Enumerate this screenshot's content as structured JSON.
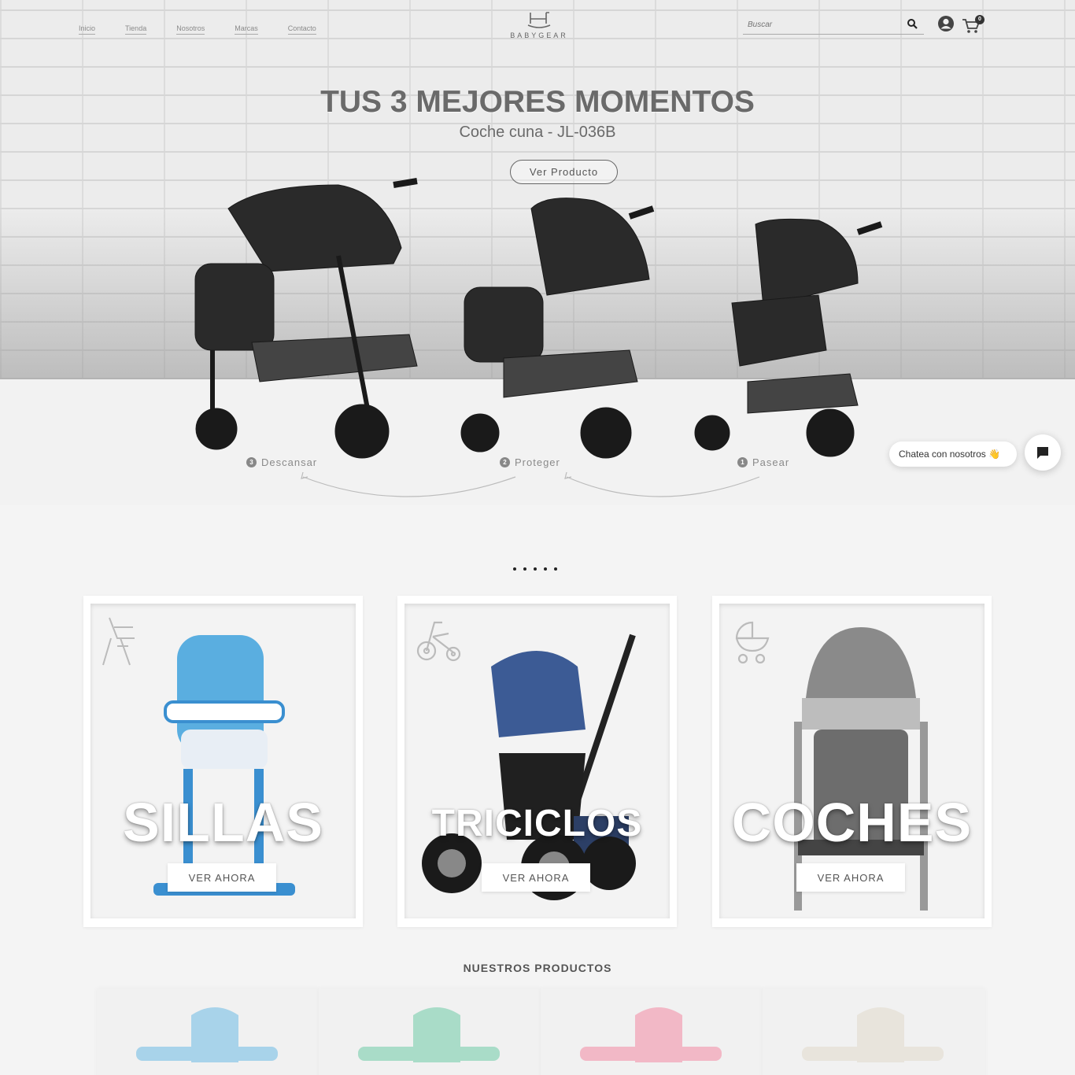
{
  "header": {
    "nav": [
      "Inicio",
      "Tienda",
      "Nosotros",
      "Marcas",
      "Contacto"
    ],
    "logo_text": "BABYGEAR",
    "search_placeholder": "Buscar",
    "cart_count": "0"
  },
  "hero": {
    "title": "TUS 3 MEJORES MOMENTOS",
    "subtitle": "Coche cuna - JL-036B",
    "button": "Ver Producto",
    "steps": [
      {
        "num": "3",
        "label": "Descansar"
      },
      {
        "num": "2",
        "label": "Proteger"
      },
      {
        "num": "1",
        "label": "Pasear"
      }
    ]
  },
  "chat": {
    "label": "Chatea con nosotros 👋"
  },
  "categories": [
    {
      "title": "SILLAS",
      "button": "VER AHORA",
      "icon": "high-chair-icon"
    },
    {
      "title": "TRICICLOS",
      "button": "VER AHORA",
      "icon": "tricycle-icon"
    },
    {
      "title": "COCHES",
      "button": "VER AHORA",
      "icon": "pram-icon"
    }
  ],
  "products_section": {
    "title": "NUESTROS PRODUCTOS"
  },
  "colors": {
    "product_chairs": [
      "#a8d3ea",
      "#a9dcc8",
      "#f2b8c6",
      "#e8e4dc"
    ]
  }
}
